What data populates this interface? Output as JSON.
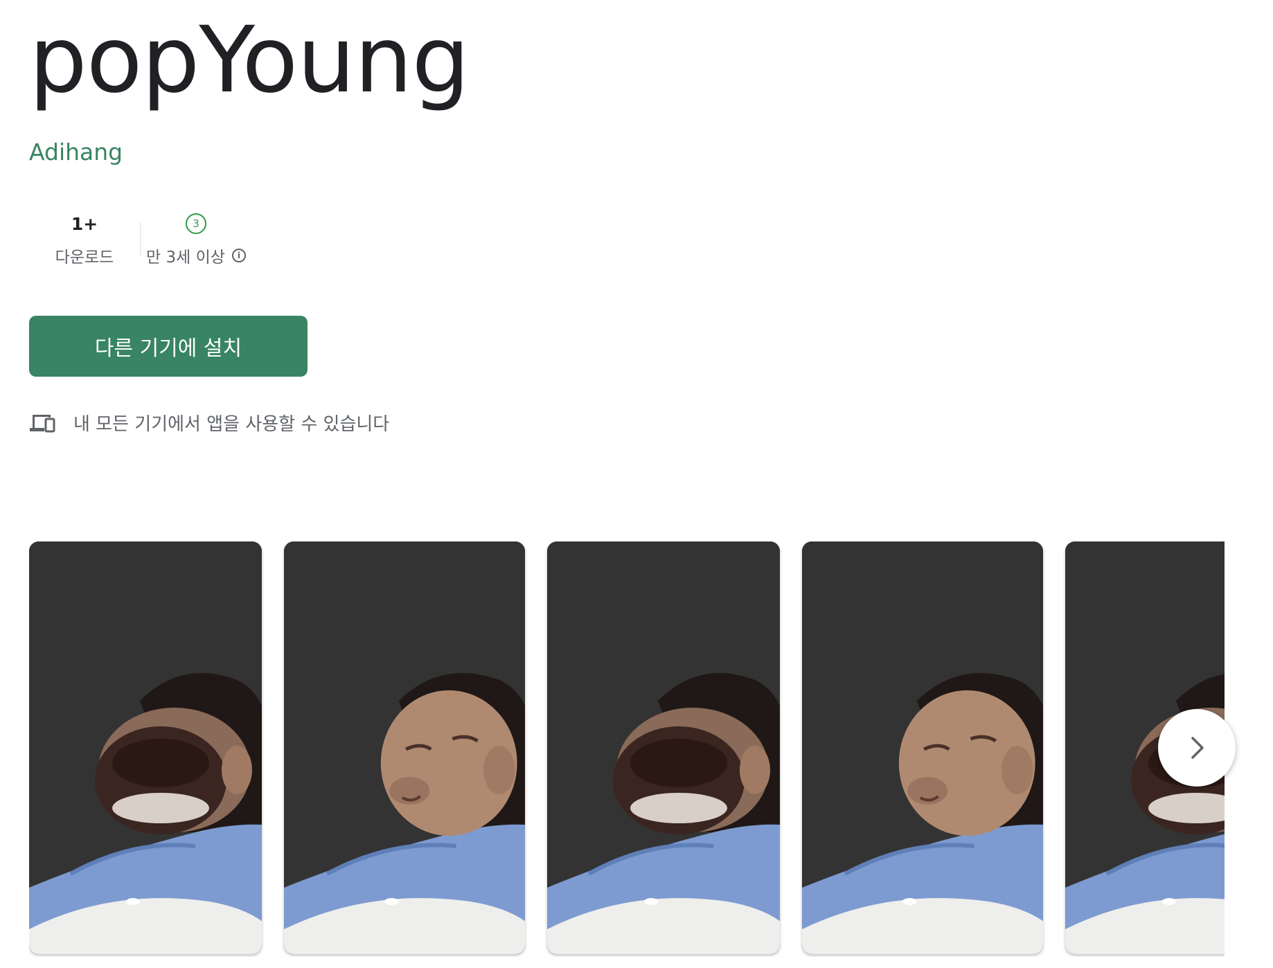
{
  "app": {
    "title": "popYoung",
    "developer": "Adihang"
  },
  "stats": {
    "downloads_value": "1+",
    "downloads_label": "다운로드",
    "rating_badge": "3",
    "rating_label": "만 3세 이상"
  },
  "install_button_label": "다른 기기에 설치",
  "device_note": "내 모든 기기에서 앱을 사용할 수 있습니다",
  "screenshots": [
    {
      "variant": "mouth-open"
    },
    {
      "variant": "mouth-closed"
    },
    {
      "variant": "mouth-open"
    },
    {
      "variant": "mouth-closed"
    },
    {
      "variant": "mouth-open"
    }
  ],
  "icons": {
    "info": "info-icon",
    "devices": "devices-icon",
    "next": "chevron-right-icon"
  },
  "colors": {
    "accent": "#388463",
    "rating_green": "#2e9b47",
    "screenshot_bg": "#333333"
  }
}
